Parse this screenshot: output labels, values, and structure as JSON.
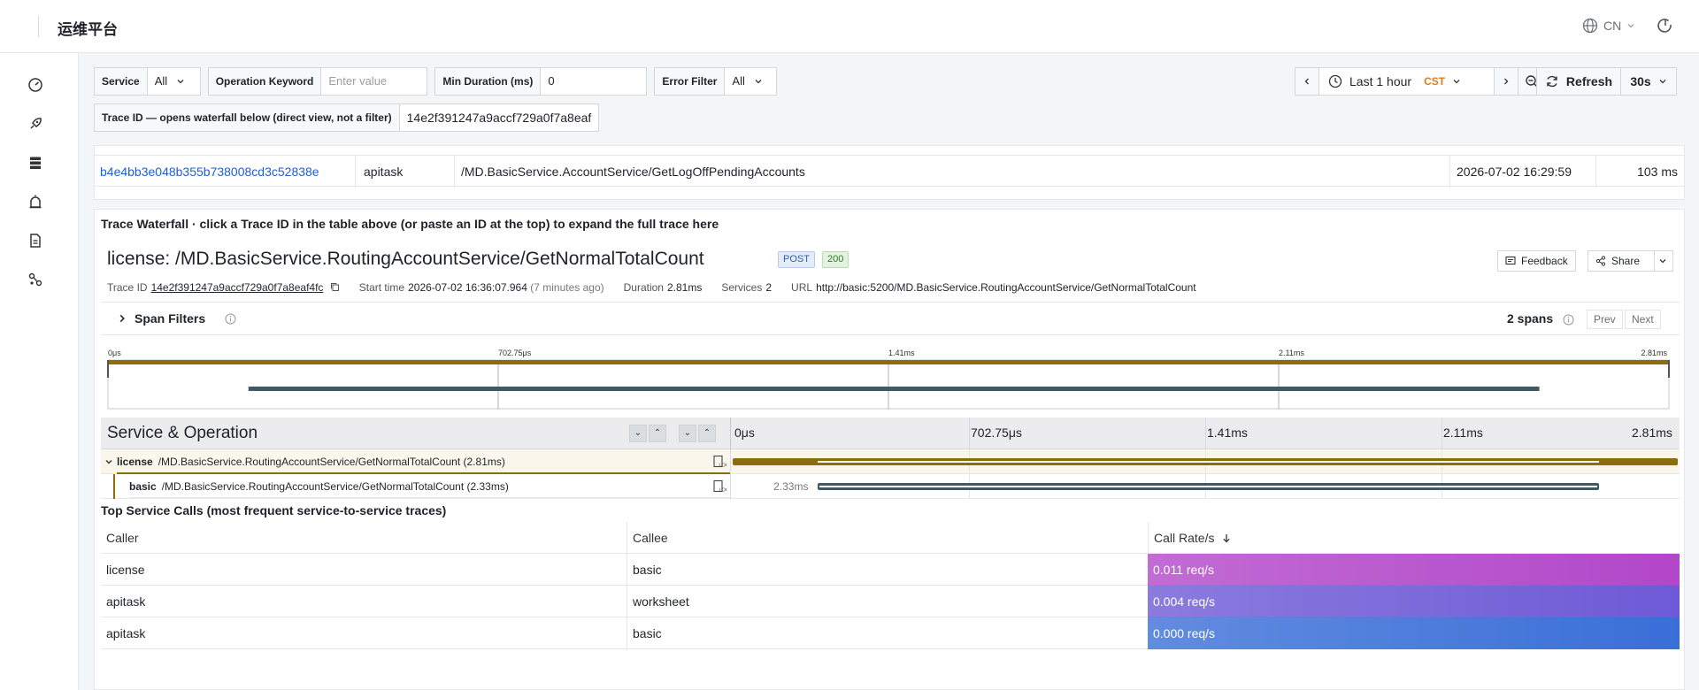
{
  "app": {
    "title": "运维平台",
    "language": "CN"
  },
  "filters": {
    "service": {
      "label": "Service",
      "value": "All"
    },
    "operation": {
      "label": "Operation Keyword",
      "placeholder": "Enter value"
    },
    "min_duration": {
      "label": "Min Duration (ms)",
      "value": "0"
    },
    "error": {
      "label": "Error Filter",
      "value": "All"
    },
    "trace_id": {
      "label": "Trace ID — opens waterfall below (direct view, not a filter)",
      "value": "14e2f391247a9accf729a0f7a8eaf"
    }
  },
  "time": {
    "range": "Last 1 hour",
    "tz": "CST",
    "refresh_label": "Refresh",
    "interval": "30s"
  },
  "trace_row": {
    "trace_id": "b4e4bb3e048b355b738008cd3c52838e",
    "service": "apitask",
    "operation": "/MD.BasicService.AccountService/GetLogOffPendingAccounts",
    "time": "2026-07-02 16:29:59",
    "duration": "103 ms"
  },
  "waterfall": {
    "caption": "Trace Waterfall · click a Trace ID in the table above (or paste an ID at the top) to expand the full trace here",
    "title": "license: /MD.BasicService.RoutingAccountService/GetNormalTotalCount",
    "method": "POST",
    "status": "200",
    "feedback": "Feedback",
    "share": "Share",
    "meta": {
      "trace_id_label": "Trace ID",
      "trace_id": "14e2f391247a9accf729a0f7a8eaf4fc",
      "start_label": "Start time",
      "start": "2026-07-02 16:36:07.964",
      "start_ago": "(7 minutes ago)",
      "duration_label": "Duration",
      "duration": "2.81ms",
      "services_label": "Services",
      "services": "2",
      "url_label": "URL",
      "url": "http://basic:5200/MD.BasicService.RoutingAccountService/GetNormalTotalCount"
    },
    "span_filters": {
      "label": "Span Filters",
      "count": "2 spans",
      "prev": "Prev",
      "next": "Next"
    },
    "ticks": [
      "0μs",
      "702.75μs",
      "1.41ms",
      "2.11ms",
      "2.81ms"
    ],
    "so_title": "Service & Operation",
    "spans": [
      {
        "service": "license",
        "operation": "/MD.BasicService.RoutingAccountService/GetNormalTotalCount (2.81ms)",
        "start": 0.0,
        "end": 1.0,
        "label": ""
      },
      {
        "service": "basic",
        "operation": "/MD.BasicService.RoutingAccountService/GetNormalTotalCount (2.33ms)",
        "start": 0.09,
        "end": 0.917,
        "label": "2.33ms"
      }
    ]
  },
  "calls": {
    "title": "Top Service Calls (most frequent service-to-service traces)",
    "headers": {
      "caller": "Caller",
      "callee": "Callee",
      "rate": "Call Rate/s"
    },
    "rows": [
      {
        "caller": "license",
        "callee": "basic",
        "rate": "0.011 req/s"
      },
      {
        "caller": "apitask",
        "callee": "worksheet",
        "rate": "0.004 req/s"
      },
      {
        "caller": "apitask",
        "callee": "basic",
        "rate": "0.000 req/s"
      }
    ]
  },
  "colors": {
    "link": "#1f5fd1",
    "accent": "#e07a1a",
    "span_root": "#8c6d0d",
    "span_child": "#3d5a66",
    "rate_1": "#b247c9",
    "rate_2": "#6e5ad6",
    "rate_3": "#3a6fd8"
  }
}
